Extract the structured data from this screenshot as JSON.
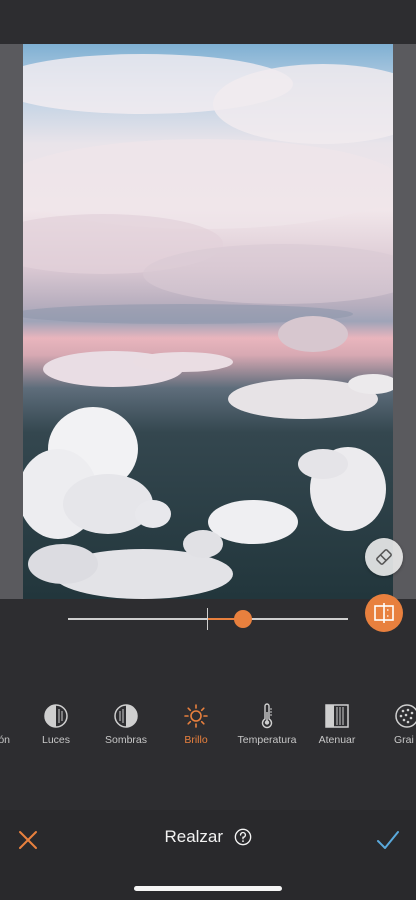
{
  "accent_color": "#e8803e",
  "slider": {
    "value": 0.25,
    "min": -1,
    "max": 1
  },
  "tools": [
    {
      "label": "ón",
      "icon": "circle-half-icon",
      "active": false
    },
    {
      "label": "Luces",
      "icon": "lights-icon",
      "active": false
    },
    {
      "label": "Sombras",
      "icon": "shadows-icon",
      "active": false
    },
    {
      "label": "Brillo",
      "icon": "sun-icon",
      "active": true
    },
    {
      "label": "Temperatura",
      "icon": "thermometer-icon",
      "active": false
    },
    {
      "label": "Atenuar",
      "icon": "fade-icon",
      "active": false
    },
    {
      "label": "Grai",
      "icon": "grain-icon",
      "active": false
    }
  ],
  "bottom_bar": {
    "title": "Realzar",
    "close_icon": "close-icon",
    "help_icon": "help-icon",
    "confirm_icon": "checkmark-icon"
  },
  "canvas": {
    "eraser_icon": "eraser-icon",
    "compare_icon": "compare-icon"
  }
}
